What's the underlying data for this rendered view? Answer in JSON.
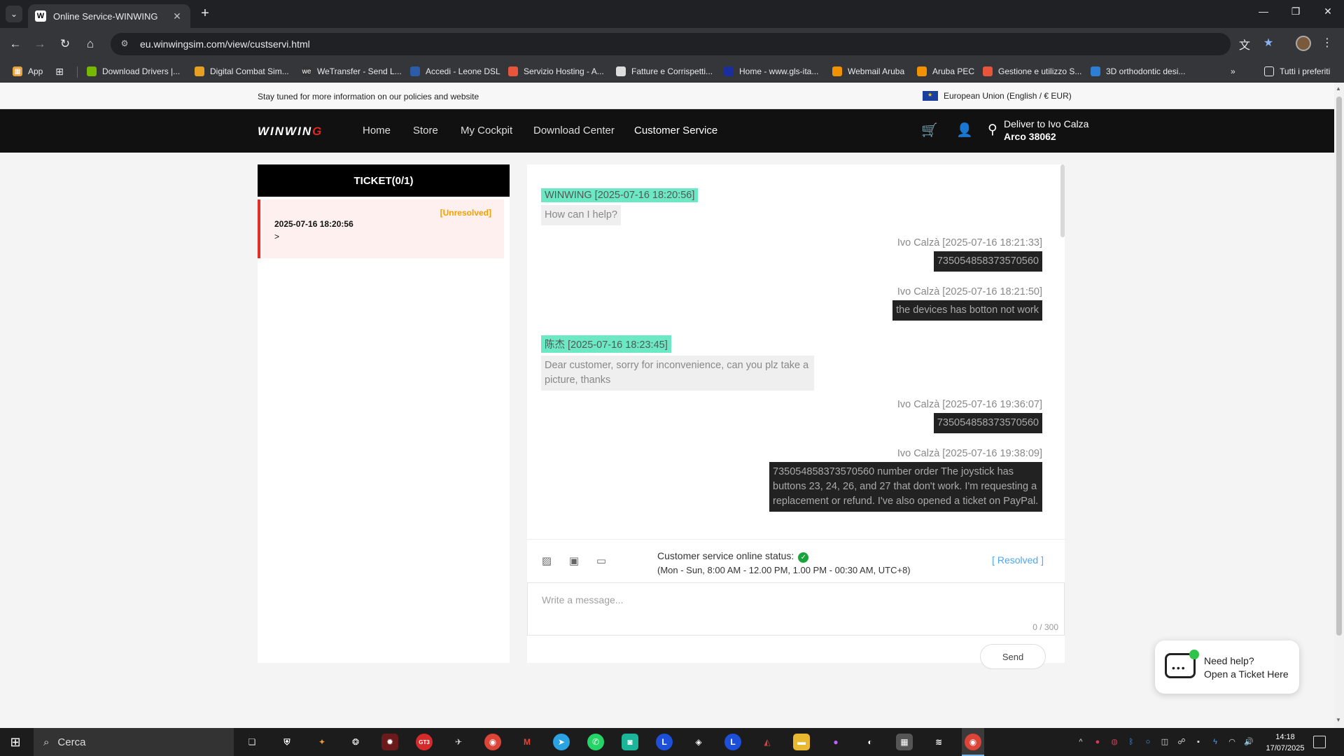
{
  "browser": {
    "tab_title": "Online Service-WINWING",
    "favicon_letter": "W",
    "url": "eu.winwingsim.com/view/custservi.html",
    "bookmarks": [
      {
        "label": "App",
        "color": "#e8a33d"
      },
      {
        "label": "Download Drivers |...",
        "color": "#76b900"
      },
      {
        "label": "Digital Combat Sim...",
        "color": "#e8a020"
      },
      {
        "label": "WeTransfer - Send L...",
        "color": "#333333"
      },
      {
        "label": "Accedi - Leone DSL",
        "color": "#2a5ca8"
      },
      {
        "label": "Servizio Hosting - A...",
        "color": "#e9553a"
      },
      {
        "label": "Fatture e Corrispetti...",
        "color": "#dddddd"
      },
      {
        "label": "Home - www.gls-ita...",
        "color": "#1a2ea0"
      },
      {
        "label": "Webmail Aruba",
        "color": "#f29200"
      },
      {
        "label": "Aruba PEC",
        "color": "#f29200"
      },
      {
        "label": "Gestione e utilizzo S...",
        "color": "#e9553a"
      },
      {
        "label": "3D orthodontic desi...",
        "color": "#2d7fd6"
      }
    ],
    "all_bookmarks": "Tutti i preferiti"
  },
  "site": {
    "announcement": "Stay tuned for more information on our policies and website",
    "region": "European Union (English / € EUR)",
    "logo_main": "WINWIN",
    "logo_accent": "G",
    "nav": [
      "Home",
      "Store",
      "My Cockpit",
      "Download Center",
      "Customer Service"
    ],
    "deliver_line1": "Deliver to Ivo Calza",
    "deliver_line2": "Arco 38062"
  },
  "tickets": {
    "header": "TICKET(0/1)",
    "items": [
      {
        "status": "[Unresolved]",
        "date": "2025-07-16 18:20:56",
        "arrow": ">"
      }
    ]
  },
  "chat": {
    "messages": [
      {
        "side": "left",
        "sender": "WINWING [2025-07-16 18:20:56]",
        "text": "How can I help?"
      },
      {
        "side": "right",
        "sender": "Ivo Calzà [2025-07-16 18:21:33]",
        "text": "735054858373570560"
      },
      {
        "side": "right",
        "sender": "Ivo Calzà [2025-07-16 18:21:50]",
        "text": "the devices has botton not work"
      },
      {
        "side": "left",
        "sender": "陈杰 [2025-07-16 18:23:45]",
        "text": "Dear customer, sorry for inconvenience, can you plz take a picture, thanks"
      },
      {
        "side": "right",
        "sender": "Ivo Calzà [2025-07-16 19:36:07]",
        "text": "735054858373570560"
      },
      {
        "side": "right",
        "sender": "Ivo Calzà [2025-07-16 19:38:09]",
        "text": "735054858373570560 number order The joystick has buttons 23, 24, 26, and 27 that don't work. I'm requesting a replacement or refund. I've also opened a ticket on PayPal."
      }
    ],
    "status_label": "Customer service online status:",
    "hours": "(Mon - Sun, 8:00 AM - 12.00 PM, 1.00 PM - 00:30 AM, UTC+8)",
    "resolved_label": "[ Resolved ]",
    "placeholder": "Write a message...",
    "counter": "0 / 300",
    "send_label": "Send"
  },
  "help_widget": {
    "line1": "Need help?",
    "line2": "Open a Ticket Here"
  },
  "taskbar": {
    "search_label": "Cerca",
    "time": "14:18",
    "date": "17/07/2025"
  }
}
